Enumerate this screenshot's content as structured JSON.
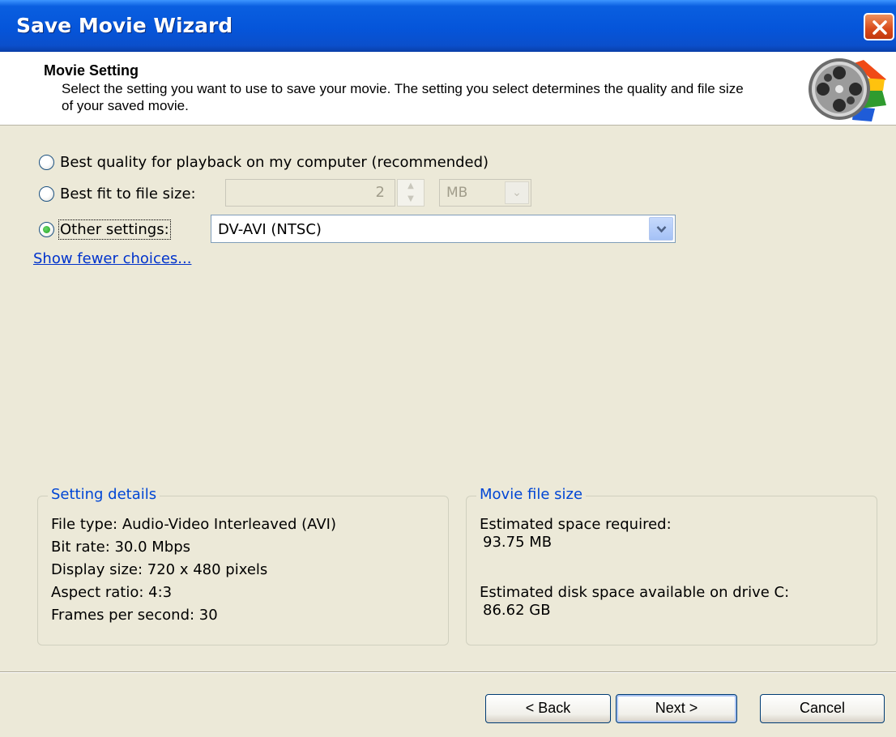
{
  "window": {
    "title": "Save Movie Wizard"
  },
  "header": {
    "title": "Movie Setting",
    "description": "Select the setting you want to use to save your movie. The setting you select determines the quality and file size of your saved movie."
  },
  "options": {
    "best_quality": {
      "label": "Best quality for playback on my computer (recommended)",
      "checked": false
    },
    "best_fit": {
      "label": "Best fit to file size:",
      "checked": false,
      "value": "2",
      "unit": "MB"
    },
    "other": {
      "label": "Other settings:",
      "checked": true,
      "value": "DV-AVI (NTSC)"
    }
  },
  "link": {
    "label": "Show fewer choices..."
  },
  "setting_details": {
    "legend": "Setting details",
    "lines": [
      "File type: Audio-Video Interleaved (AVI)",
      "Bit rate: 30.0 Mbps",
      "Display size: 720 x 480 pixels",
      "Aspect ratio: 4:3",
      "Frames per second: 30"
    ]
  },
  "movie_file_size": {
    "legend": "Movie file size",
    "required_label": "Estimated space required:",
    "required_value": "93.75 MB",
    "available_label": "Estimated disk space available on drive C:",
    "available_value": "86.62 GB"
  },
  "buttons": {
    "back": "< Back",
    "next": "Next >",
    "cancel": "Cancel"
  },
  "icons": {
    "close": "close-icon",
    "movie": "film-reel-icon"
  }
}
